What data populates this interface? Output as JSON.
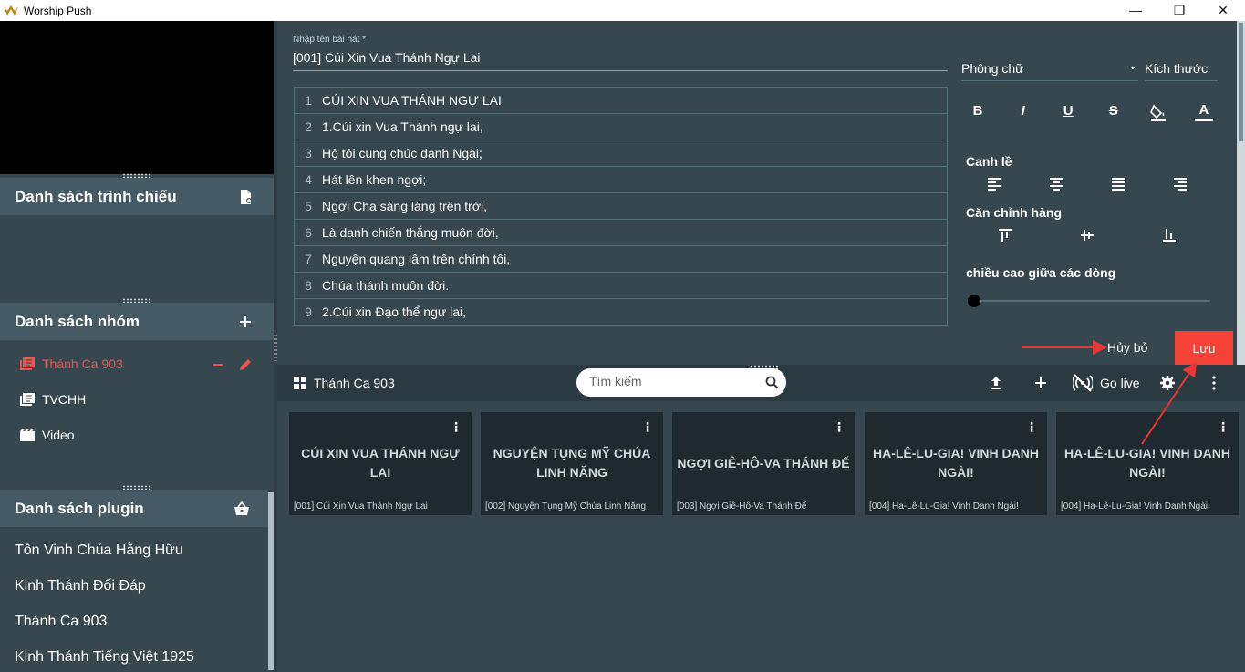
{
  "window": {
    "title": "Worship Push",
    "minimize": "—",
    "maximize": "❐",
    "close": "✕"
  },
  "left": {
    "presentation_list": {
      "title": "Danh sách trình chiếu"
    },
    "group_list": {
      "title": "Danh sách nhóm",
      "items": [
        {
          "label": "Thánh Ca 903",
          "active": true
        },
        {
          "label": "TVCHH",
          "active": false
        },
        {
          "label": "Video",
          "active": false
        }
      ]
    },
    "plugin_list": {
      "title": "Danh sách plugin",
      "items": [
        "Tôn Vinh Chúa Hằng Hữu",
        "Kinh Thánh Đối Đáp",
        "Thánh Ca 903",
        "Kinh Thánh Tiếng Việt 1925"
      ]
    }
  },
  "editor": {
    "song_label": "Nhập tên bài hát *",
    "song_value": "[001] Cúi Xin Vua Thánh Ngự Lai",
    "lyrics": [
      {
        "n": "1",
        "text": "CÚI XIN VUA THÁNH NGỰ LAI"
      },
      {
        "n": "2",
        "text": "1.Cúi xin Vua Thánh ngự lai,"
      },
      {
        "n": "3",
        "text": "Hộ tôi cung chúc danh Ngài;"
      },
      {
        "n": "4",
        "text": "Hát lên khen ngợi;"
      },
      {
        "n": "5",
        "text": "Ngợi Cha sáng láng trên trời,"
      },
      {
        "n": "6",
        "text": "Là danh chiến thắng muôn đời,"
      },
      {
        "n": "7",
        "text": "Nguyện quang lâm trên chính tôi,"
      },
      {
        "n": "8",
        "text": "Chúa thánh muôn đời."
      },
      {
        "n": "9",
        "text": "2.Cúi xin Đạo thể ngự lai,"
      }
    ],
    "font_label": "Phông chữ",
    "size_label": "Kích thước",
    "format_icons": {
      "bold": "B",
      "italic": "I",
      "underline": "U",
      "strike": "S",
      "text_color": "A"
    },
    "align_label": "Canh lề",
    "valign_label": "Căn chỉnh hàng",
    "line_height_label": "chiều cao giữa các dòng",
    "line_height_value": 0,
    "cancel": "Hủy bỏ",
    "save": "Lưu"
  },
  "toolbar": {
    "group_title": "Thánh Ca 903",
    "search_placeholder": "Tìm kiếm",
    "golive": "Go live"
  },
  "cards": [
    {
      "title": "CÚI XIN VUA THÁNH NGỰ LAI",
      "name": "[001] Cúi Xin Vua Thánh Ngự Lai"
    },
    {
      "title": "NGUYỆN TỤNG MỸ CHÚA LINH NĂNG",
      "name": "[002] Nguyện Tụng Mỹ Chúa Linh Năng"
    },
    {
      "title": "NGỢI GIÊ-HÔ-VA THÁNH ĐẾ",
      "name": "[003] Ngợi Giê-Hô-Va Thánh Đế"
    },
    {
      "title": "HA-LÊ-LU-GIA! VINH DANH NGÀI!",
      "name": "[004] Ha-Lê-Lu-Gia! Vinh Danh Ngài!"
    },
    {
      "title": "HA-LÊ-LU-GIA! VINH DANH NGÀI!",
      "name": "[004] Ha-Lê-Lu-Gia! Vinh Danh Ngài!"
    }
  ],
  "colors": {
    "accent_red": "#f44336",
    "active_text": "#ef5350",
    "panel_bg": "#37474f",
    "header_bg": "#455a64"
  }
}
